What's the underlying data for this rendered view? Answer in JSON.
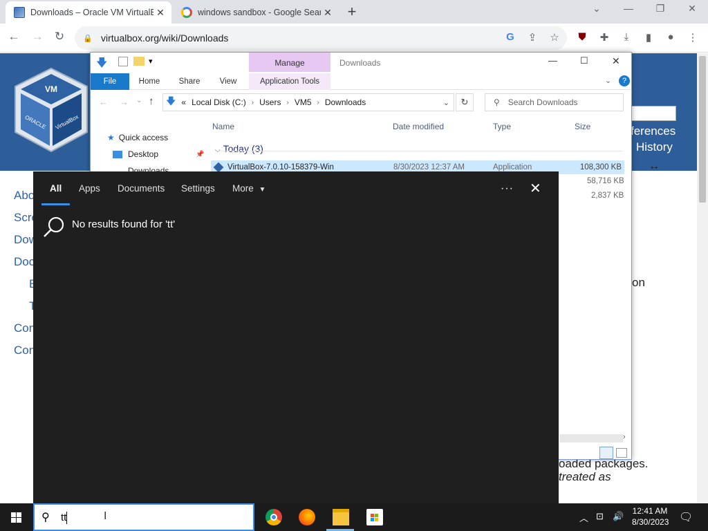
{
  "browser": {
    "tabs": [
      {
        "title": "Downloads – Oracle VM VirtualBox",
        "active": true
      },
      {
        "title": "windows sandbox - Google Search",
        "active": false
      }
    ],
    "url": "virtualbox.org/wiki/Downloads"
  },
  "webpage": {
    "sidebar_links": [
      "Abo",
      "Scre",
      "Dow",
      "Doc",
      "E",
      "T",
      "Com",
      "Con"
    ],
    "right_links": [
      "ferences",
      "History"
    ],
    "text_fragments": [
      "on",
      "oaded packages.",
      "treated as"
    ],
    "logo_text": [
      "ORACLE",
      "VirtualBox"
    ]
  },
  "explorer": {
    "manage_tab": "Manage",
    "window_title": "Downloads",
    "ribbon_tabs": [
      "File",
      "Home",
      "Share",
      "View",
      "Application Tools"
    ],
    "address": {
      "prefix": "«",
      "crumbs": [
        "Local Disk (C:)",
        "Users",
        "VM5",
        "Downloads"
      ]
    },
    "search_placeholder": "Search Downloads",
    "columns": {
      "name": "Name",
      "date": "Date modified",
      "type": "Type",
      "size": "Size"
    },
    "nav": {
      "quick_access": "Quick access",
      "desktop": "Desktop",
      "downloads": "Downloads"
    },
    "group": "Today (3)",
    "files": [
      {
        "name": "VirtualBox-7.0.10-158379-Win",
        "date": "8/30/2023 12:37 AM",
        "type": "Application",
        "size": "108,300 KB"
      },
      {
        "name": "",
        "date": "",
        "type": "",
        "size": "58,716 KB"
      },
      {
        "name": "",
        "date": "",
        "type": "",
        "size": "2,837 KB"
      }
    ]
  },
  "search_panel": {
    "filters": [
      "All",
      "Apps",
      "Documents",
      "Settings",
      "More"
    ],
    "more_ellipsis": "···",
    "no_results": "No results found for 'tt'"
  },
  "taskbar": {
    "search_query": "tt",
    "time": "12:41 AM",
    "date": "8/30/2023"
  }
}
